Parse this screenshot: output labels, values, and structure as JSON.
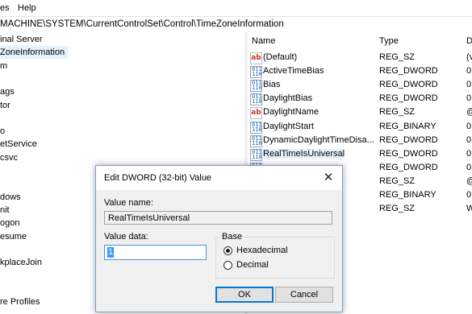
{
  "menubar": {
    "items": [
      "es",
      "Help"
    ]
  },
  "address": {
    "path": "MACHINE\\SYSTEM\\CurrentControlSet\\Control\\TimeZoneInformation"
  },
  "tree": {
    "items": [
      {
        "label": "inal Server",
        "selected": false
      },
      {
        "label": "ZoneInformation",
        "selected": true
      },
      {
        "label": "m",
        "selected": false
      },
      {
        "label": "",
        "selected": false
      },
      {
        "label": "ags",
        "selected": false
      },
      {
        "label": "tor",
        "selected": false
      },
      {
        "label": "",
        "selected": false
      },
      {
        "label": "o",
        "selected": false
      },
      {
        "label": "etService",
        "selected": false
      },
      {
        "label": "csvc",
        "selected": false
      },
      {
        "label": "",
        "selected": false
      },
      {
        "label": "",
        "selected": false
      },
      {
        "label": "dows",
        "selected": false
      },
      {
        "label": "nit",
        "selected": false
      },
      {
        "label": "ogon",
        "selected": false
      },
      {
        "label": "esume",
        "selected": false
      },
      {
        "label": "",
        "selected": false
      },
      {
        "label": "kplaceJoin",
        "selected": false
      },
      {
        "label": "",
        "selected": false
      },
      {
        "label": "",
        "selected": false
      },
      {
        "label": "re Profiles",
        "selected": false
      }
    ]
  },
  "list": {
    "headers": {
      "name": "Name",
      "type": "Type",
      "data": "D"
    },
    "rows": [
      {
        "icon": "string-value-icon",
        "name": "(Default)",
        "type": "REG_SZ",
        "data": "(v"
      },
      {
        "icon": "binary-value-icon",
        "name": "ActiveTimeBias",
        "type": "REG_DWORD",
        "data": "0"
      },
      {
        "icon": "binary-value-icon",
        "name": "Bias",
        "type": "REG_DWORD",
        "data": "0"
      },
      {
        "icon": "binary-value-icon",
        "name": "DaylightBias",
        "type": "REG_DWORD",
        "data": "0"
      },
      {
        "icon": "string-value-icon",
        "name": "DaylightName",
        "type": "REG_SZ",
        "data": "@"
      },
      {
        "icon": "binary-value-icon",
        "name": "DaylightStart",
        "type": "REG_BINARY",
        "data": "0"
      },
      {
        "icon": "binary-value-icon",
        "name": "DynamicDaylightTimeDisa...",
        "type": "REG_DWORD",
        "data": "0"
      },
      {
        "icon": "binary-value-icon",
        "name": "RealTimeIsUniversal",
        "type": "REG_DWORD",
        "data": "0"
      },
      {
        "icon": "binary-value-icon",
        "name": "",
        "type": "REG_DWORD",
        "data": "0"
      },
      {
        "icon": "",
        "name": "",
        "type": "REG_SZ",
        "data": "@"
      },
      {
        "icon": "",
        "name": "",
        "type": "REG_BINARY",
        "data": "0"
      },
      {
        "icon": "",
        "name": "",
        "type": "REG_SZ",
        "data": "W"
      }
    ]
  },
  "dialog": {
    "title": "Edit DWORD (32-bit) Value",
    "close_glyph": "✕",
    "value_name_label": "Value name:",
    "value_name": "RealTimeIsUniversal",
    "value_data_label": "Value data:",
    "value_data": "1",
    "base_label": "Base",
    "hex_label": "Hexadecimal",
    "dec_label": "Decimal",
    "selected_base": "Hexadecimal",
    "ok_label": "OK",
    "cancel_label": "Cancel"
  }
}
